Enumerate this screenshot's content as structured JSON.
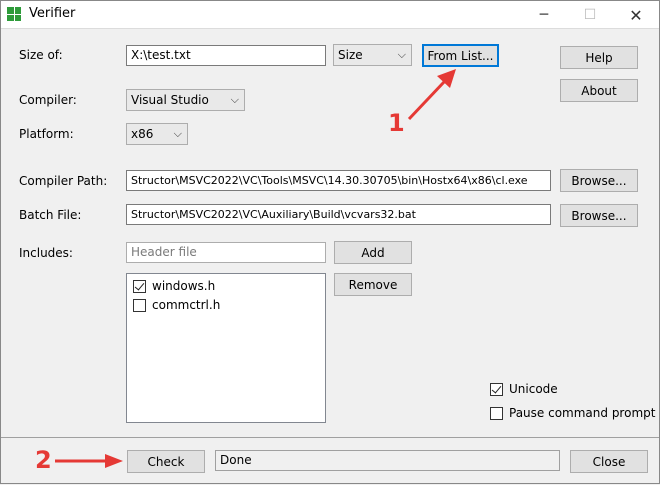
{
  "window": {
    "title": "Verifier",
    "icon": "app-grid-icon",
    "controls": {
      "minimize": "─",
      "maximize": "☐",
      "close": "✕"
    }
  },
  "form": {
    "size_of": {
      "label": "Size of:",
      "value": "X:\\test.txt",
      "mode": "Size",
      "from_list": "From List..."
    },
    "compiler": {
      "label": "Compiler:",
      "value": "Visual Studio"
    },
    "platform": {
      "label": "Platform:",
      "value": "x86"
    },
    "compiler_path": {
      "label": "Compiler Path:",
      "value": "Structor\\MSVC2022\\VC\\Tools\\MSVC\\14.30.30705\\bin\\Hostx64\\x86\\cl.exe",
      "browse": "Browse..."
    },
    "batch_file": {
      "label": "Batch File:",
      "value": "Structor\\MSVC2022\\VC\\Auxiliary\\Build\\vcvars32.bat",
      "browse": "Browse..."
    },
    "includes": {
      "label": "Includes:",
      "placeholder": "Header file",
      "add": "Add",
      "remove": "Remove",
      "items": [
        {
          "name": "windows.h",
          "checked": true
        },
        {
          "name": "commctrl.h",
          "checked": false
        }
      ]
    },
    "options": {
      "unicode": {
        "label": "Unicode",
        "checked": true
      },
      "pause": {
        "label": "Pause command prompt",
        "checked": false
      }
    }
  },
  "side": {
    "help": "Help",
    "about": "About"
  },
  "footer": {
    "check": "Check",
    "status": "Done",
    "close": "Close"
  },
  "annotations": {
    "step1": "1",
    "step2": "2",
    "color": "#e53935"
  }
}
